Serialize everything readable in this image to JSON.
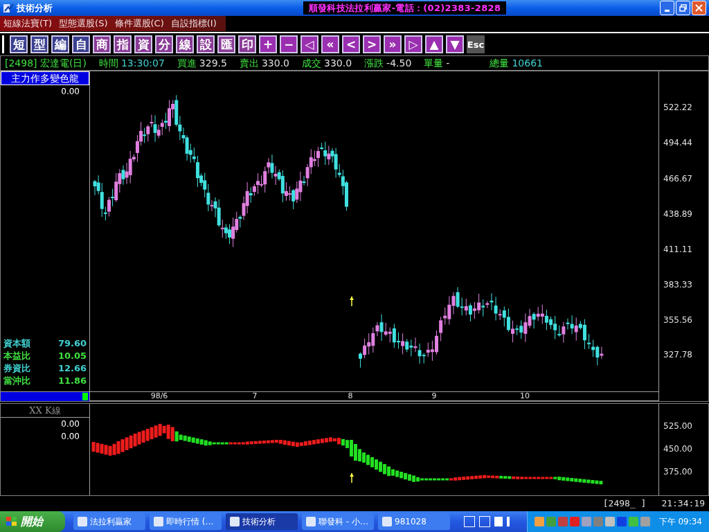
{
  "window": {
    "title": "技術分析",
    "banner": "順發科技法拉利贏家-電話：(02)2383-2828"
  },
  "menu": [
    {
      "label": "短線法寶(T)"
    },
    {
      "label": "型態選股(S)"
    },
    {
      "label": "條件選股(C)"
    },
    {
      "label": "自設指標(I)"
    }
  ],
  "toolbar": [
    {
      "label": "短",
      "kind": "key",
      "color": "#3a3f8f"
    },
    {
      "label": "型",
      "kind": "key",
      "color": "#3a3f8f"
    },
    {
      "label": "編",
      "kind": "key",
      "color": "#3a3f8f"
    },
    {
      "label": "自",
      "kind": "key",
      "color": "#3a3f8f"
    },
    {
      "label": "商",
      "kind": "key",
      "color": "#8a3a96"
    },
    {
      "label": "指",
      "kind": "key",
      "color": "#8a3a96"
    },
    {
      "label": "資",
      "kind": "key",
      "color": "#8a3a96"
    },
    {
      "label": "分",
      "kind": "key",
      "color": "#8a3a96"
    },
    {
      "label": "線",
      "kind": "key",
      "color": "#8a3a96"
    },
    {
      "label": "設",
      "kind": "key",
      "color": "#8a3a96"
    },
    {
      "label": "匯",
      "kind": "key",
      "color": "#8a3a96"
    },
    {
      "label": "印",
      "kind": "key",
      "color": "#8a3a96"
    },
    {
      "label": "+",
      "kind": "key",
      "color": "#9a2fb0"
    },
    {
      "label": "−",
      "kind": "key",
      "color": "#9a2fb0"
    },
    {
      "label": "◁",
      "kind": "key",
      "color": "#9a2fb0"
    },
    {
      "label": "«",
      "kind": "key",
      "color": "#9a2fb0"
    },
    {
      "label": "<",
      "kind": "key",
      "color": "#9a2fb0"
    },
    {
      "label": ">",
      "kind": "key",
      "color": "#9a2fb0"
    },
    {
      "label": "»",
      "kind": "key",
      "color": "#9a2fb0"
    },
    {
      "label": "▷",
      "kind": "key",
      "color": "#9a2fb0"
    },
    {
      "label": "▲",
      "kind": "key",
      "color": "#9a2fb0"
    },
    {
      "label": "▼",
      "kind": "key",
      "color": "#9a2fb0"
    },
    {
      "label": "Esc",
      "kind": "esc",
      "color": "#555555"
    }
  ],
  "quote": {
    "symbol": "[2498] 宏達電(日)",
    "fields": [
      {
        "label": "時間",
        "value": "13:30:07",
        "color": "#40d0d0"
      },
      {
        "label": "買進",
        "value": "329.5",
        "color": "#e0e0e0"
      },
      {
        "label": "賣出",
        "value": "330.0",
        "color": "#e0e0e0"
      },
      {
        "label": "成交",
        "value": "330.0",
        "color": "#e0e0e0"
      },
      {
        "label": "漲跌",
        "value": "-4.50",
        "color": "#e0e0e0"
      },
      {
        "label": "單量",
        "value": "-",
        "color": "#e0e0e0"
      },
      {
        "label": "總量",
        "value": "10661",
        "color": "#40d0d0"
      }
    ]
  },
  "main_panel": {
    "title": "主力作多變色龍",
    "value": "0.00",
    "stats": [
      {
        "label": "資本額",
        "value": "79.60",
        "color": "#40d0d0"
      },
      {
        "label": "本益比",
        "value": "10.05",
        "color": "#40e040"
      },
      {
        "label": "券資比",
        "value": "12.66",
        "color": "#40d0d0"
      },
      {
        "label": "當沖比",
        "value": "11.86",
        "color": "#40e040"
      }
    ],
    "y_labels": [
      "522.22",
      "494.44",
      "466.67",
      "438.89",
      "411.11",
      "383.33",
      "355.56",
      "327.78"
    ],
    "x_labels": [
      "98/6",
      "7",
      "8",
      "9",
      "10"
    ]
  },
  "lower_panel": {
    "title": "XX K線",
    "values": [
      "0.00",
      "0.00"
    ],
    "y_labels": [
      "525.00",
      "450.00",
      "375.00"
    ]
  },
  "status": {
    "code": "[2498_ ]",
    "time": "21:34:19"
  },
  "taskbar": {
    "start": "開始",
    "tasks": [
      {
        "label": "法拉利贏家",
        "selected": false
      },
      {
        "label": "即時行情 (…",
        "selected": false
      },
      {
        "label": "技術分析",
        "selected": true
      },
      {
        "label": "聯發科 - 小…",
        "selected": false
      },
      {
        "label": "981028",
        "selected": false
      }
    ],
    "clock": "下午 09:34"
  }
}
